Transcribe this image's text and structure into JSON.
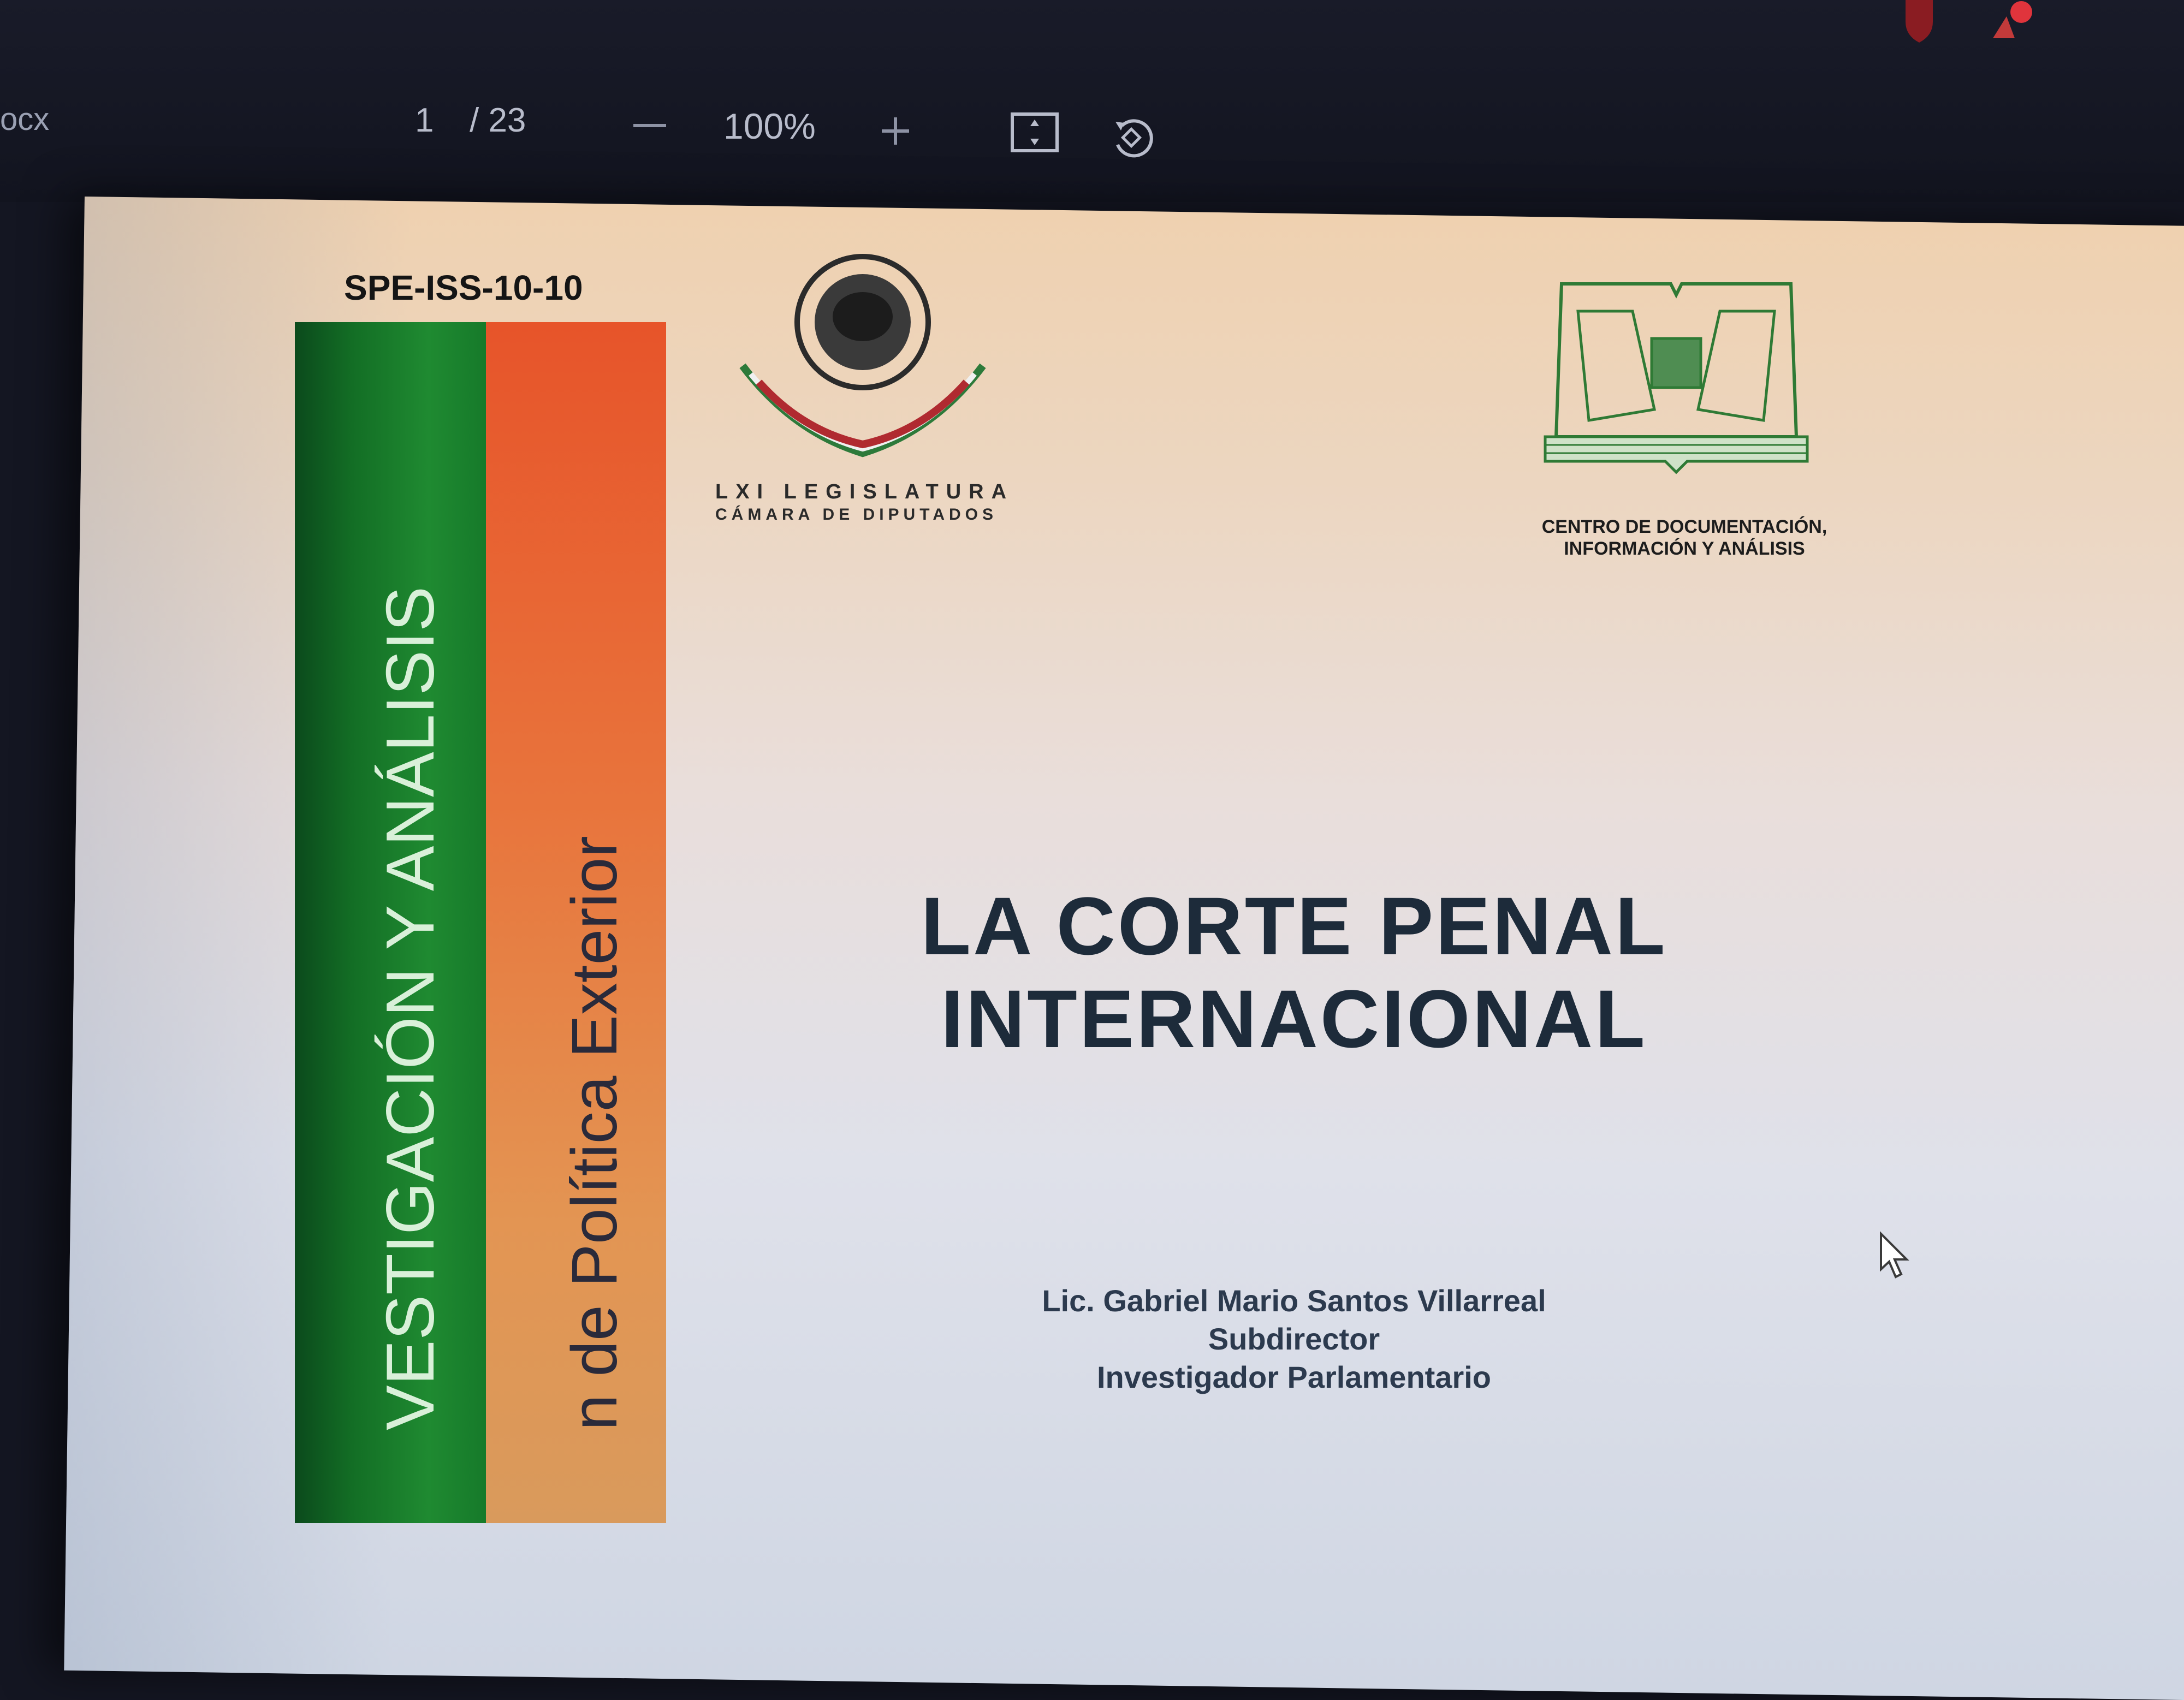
{
  "viewer": {
    "document_name": "ocx",
    "page_current": "1",
    "page_total": "/ 23",
    "zoom": "100%"
  },
  "cover": {
    "code": "SPE-ISS-10-10",
    "band_green_text": "VESTIGACIÓN Y ANÁLISIS",
    "band_orange_text": "n de Política Exterior",
    "seal_line1": "LXI LEGISLATURA",
    "seal_line2": "CÁMARA DE DIPUTADOS",
    "cedia_line1": "CENTRO DE DOCUMENTACIÓN,",
    "cedia_line2": "INFORMACIÓN Y ANÁLISIS",
    "title_line1": "LA CORTE PENAL",
    "title_line2": "INTERNACIONAL",
    "author_name": "Lic. Gabriel Mario Santos Villarreal",
    "author_role1": "Subdirector",
    "author_role2": "Investigador Parlamentario"
  },
  "colors": {
    "band_green": "#1f8a31",
    "band_orange": "#e7542a",
    "title": "#1d2b3a"
  },
  "icons": [
    "zoom-out-icon",
    "zoom-in-icon",
    "fit-page-icon",
    "rotate-icon",
    "shield-icon",
    "notification-icon",
    "mouse-cursor-icon"
  ]
}
